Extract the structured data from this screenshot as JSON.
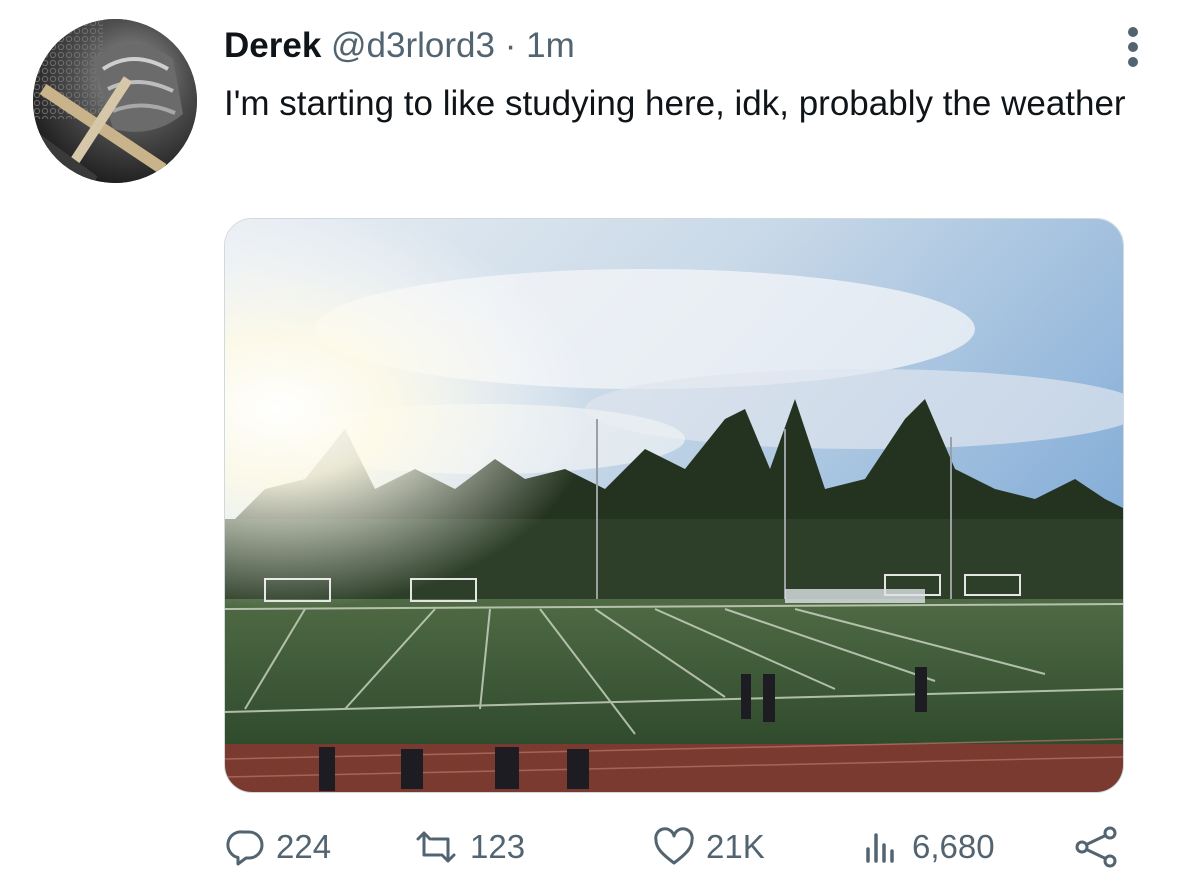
{
  "tweet": {
    "display_name": "Derek",
    "handle": "@d3rlord3",
    "separator": "·",
    "time": "1m",
    "text": "I'm starting to like studying here, idk, probably the weather"
  },
  "actions": {
    "replies": "224",
    "retweets": "123",
    "likes": "21K",
    "views": "6,680"
  },
  "icons": {
    "reply": "reply-icon",
    "retweet": "retweet-icon",
    "like": "heart-icon",
    "views": "analytics-icon",
    "share": "share-icon",
    "more": "more-vertical-icon"
  },
  "colors": {
    "text": "#0f1419",
    "secondary": "#536471"
  }
}
